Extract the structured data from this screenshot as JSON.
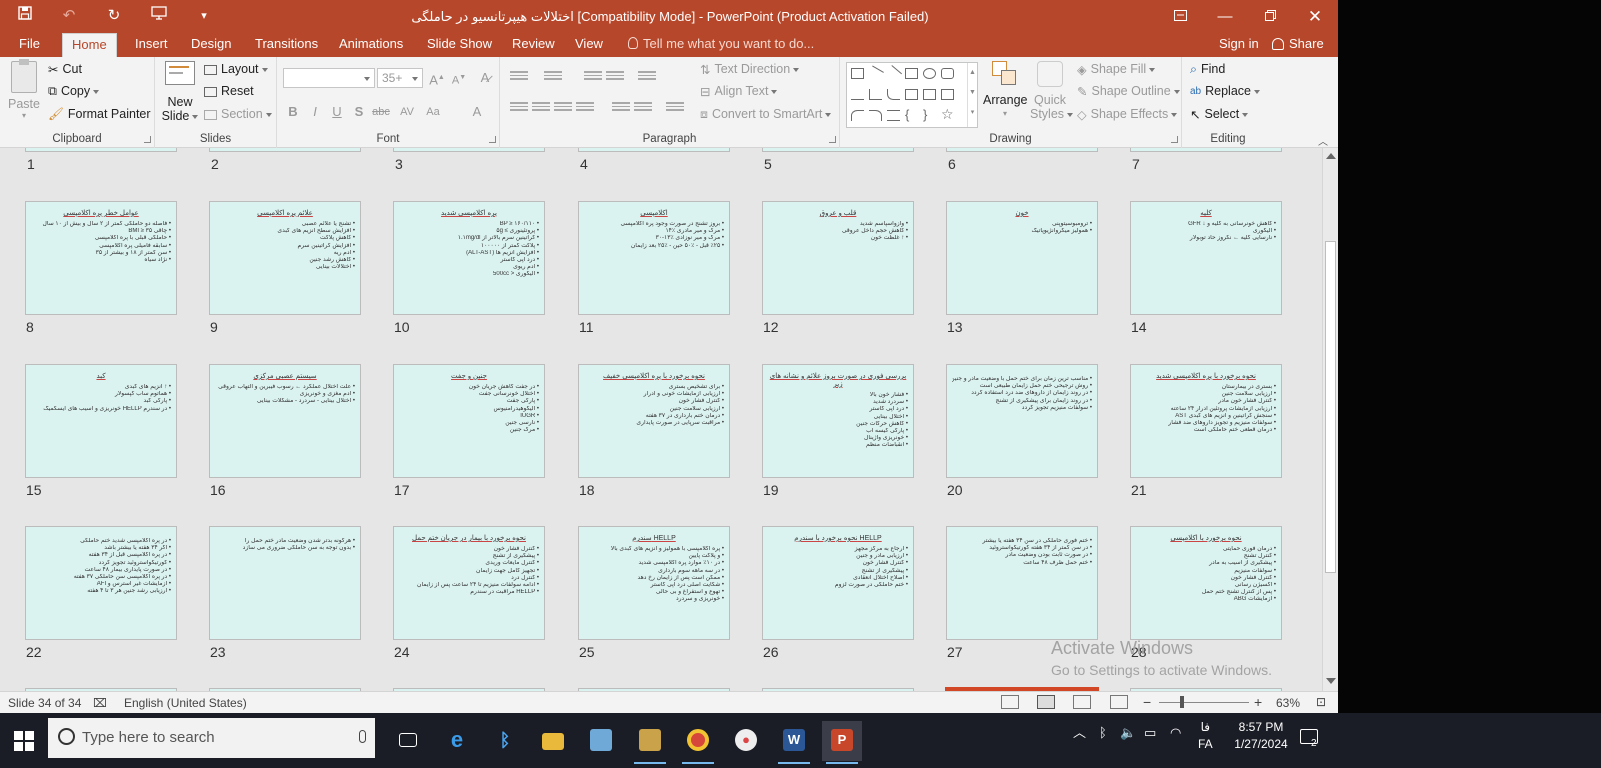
{
  "window": {
    "title": "اختلالات هیپرتانسیو در حاملگی [Compatibility Mode] - PowerPoint (Product Activation Failed)"
  },
  "tabs": [
    "File",
    "Home",
    "Insert",
    "Design",
    "Transitions",
    "Animations",
    "Slide Show",
    "Review",
    "View"
  ],
  "active_tab": "Home",
  "tell_me": "Tell me what you want to do...",
  "account": {
    "sign_in": "Sign in",
    "share": "Share"
  },
  "ribbon": {
    "clipboard": {
      "label": "Clipboard",
      "paste": "Paste",
      "cut": "Cut",
      "copy": "Copy",
      "format_painter": "Format Painter"
    },
    "slides": {
      "label": "Slides",
      "new_slide_1": "New",
      "new_slide_2": "Slide",
      "layout": "Layout",
      "reset": "Reset",
      "section": "Section"
    },
    "font": {
      "label": "Font",
      "font_name": "",
      "font_size": "35+"
    },
    "paragraph": {
      "label": "Paragraph",
      "text_direction": "Text Direction",
      "align_text": "Align Text",
      "convert_smartart": "Convert to SmartArt"
    },
    "drawing": {
      "label": "Drawing",
      "arrange": "Arrange",
      "quick_styles_1": "Quick",
      "quick_styles_2": "Styles",
      "shape_fill": "Shape Fill",
      "shape_outline": "Shape Outline",
      "shape_effects": "Shape Effects"
    },
    "editing": {
      "label": "Editing",
      "find": "Find",
      "replace": "Replace",
      "select": "Select"
    }
  },
  "slides_partial": [
    "1",
    "2",
    "3",
    "4",
    "5",
    "6",
    "7"
  ],
  "slides": [
    {
      "num": "8",
      "title": "عوامل خطر پره اکلامپسی",
      "lines": [
        "فاصله دو حاملگی کمتر از ۲ سال و بیش از ۱۰ سال",
        "چاقی BMI ≥ ۳۵",
        "حاملگی قبلی با پره اکلامپسی",
        "سابقه فامیلی پره اکلامپسی",
        "سن کمتر از ۱۸ و بیشتر از ۳۵",
        "نژاد سیاه"
      ]
    },
    {
      "num": "9",
      "title": "علائم پره اکلامپسی",
      "lines": [
        "تشنج یا علائم عصبی",
        "افزایش سطح آنزیم های کبدی",
        "کاهش پلاکت",
        "افزایش کراتینین سرم",
        "ادم ریه",
        "کاهش رشد جنین",
        "اختلالات بینایی"
      ]
    },
    {
      "num": "10",
      "title": "پره اکلامپسی شدید",
      "lines": [
        "BP ≥ ۱۶۰/۱۱۰",
        "پروتئینوری ≥ ۵g",
        "کراتینین سرم بالاتر از ۱.۱mg/dl",
        "پلاکت کمتر از ۱۰۰۰۰۰",
        "افزایش آنزیم ها (ALT-AST)",
        "درد اپی گاستر",
        "ادم ریوی",
        "الیگوری < 500cc"
      ]
    },
    {
      "num": "11",
      "title": "اکلامپسی",
      "lines": [
        "بروز تشنج در صورت وجود پره اکلامپسی",
        "مرگ و میر مادری ٪۱۴",
        "مرگ و میر نوزادی ٪۱۳-۳۰",
        "٪۲۵ قبل - ٪۵۰ حین - ٪۲۵ بعد زایمان"
      ]
    },
    {
      "num": "12",
      "title": "قلب و عروق",
      "lines": [
        "وازواسپاسم شدید",
        "کاهش حجم داخل عروقی",
        "↑ غلظت خون"
      ]
    },
    {
      "num": "13",
      "title": "خون",
      "lines": [
        "ترومبوسیتوپنی",
        "همولیز میکروآنژیوپاتیک"
      ]
    },
    {
      "num": "14",
      "title": "کلیه",
      "lines": [
        "کاهش خونرسانی به کلیه و ↓ GFR",
        "الیگوری",
        "نارسایی کلیه ← نکروز حاد توبولار"
      ]
    },
    {
      "num": "15",
      "title": "کبد",
      "lines": [
        "↑ آنزیم های کبدی",
        "هماتوم ساب کپسولار",
        "پارگی کبد",
        "در سندرم HELLP خونریزی و آسیب های ایسکمیک"
      ]
    },
    {
      "num": "16",
      "title": "سیستم عصبی مرکزی",
      "lines": [
        "علت اختلال عملکرد ← رسوب فیبرین و التهاب عروقی",
        "ادم مغزی و خونریزی",
        "اختلال بینایی - سردرد - مشکلات بینایی"
      ]
    },
    {
      "num": "17",
      "title": "جنین و جفت",
      "lines": [
        "در جفت کاهش جریان خون",
        "اختلال خونرسانی جفت",
        "پارگی جفت",
        "الیگوهیدرآمنیوس",
        "IUGR",
        "نارسی جنین",
        "مرگ جنین"
      ]
    },
    {
      "num": "18",
      "title": "نحوه برخورد با پره اکلامپسی خفیف",
      "lines": [
        "برای تشخیص بستری",
        "ارزیابی آزمایشات خونی و ادرار",
        "کنترل فشار خون",
        "ارزیابی سلامت جنین",
        "درمان ختم بارداری در ۳۷ هفته",
        "مراقبت سرپایی در صورت پایداری"
      ]
    },
    {
      "num": "19",
      "title": "بررسی فوری در صورت بروز علائم و نشانه های زیر",
      "lines": [
        "فشار خون بالا",
        "سردرد شدید",
        "درد اپی گاستر",
        "اختلال بینایی",
        "کاهش حرکات جنین",
        "پارگی کیسه آب",
        "خونریزی واژینال",
        "انقباضات منظم"
      ]
    },
    {
      "num": "20",
      "title": "",
      "lines": [
        "مناسب ترین زمان برای ختم حمل با وضعیت مادر و جنین بستگی دارد",
        "روش ترجیحی ختم حمل زایمان طبیعی است",
        "در روند زایمان از داروهای ضد درد استفاده گردد",
        "در روند زایمان برای پیشگیری از تشنج",
        "سولفات منیزیم تجویز گردد"
      ]
    },
    {
      "num": "21",
      "title": "نحوه برخورد با پره اکلامپسی شدید",
      "lines": [
        "بستری در بیمارستان",
        "ارزیابی سلامت جنین",
        "کنترل فشار خون مادر",
        "ارزیابی آزمایشات پروتئین ادرار ۲۴ ساعته",
        "سنجش کراتینین و آنزیم های کبدی AST",
        "سولفات منیزیم و تجویز داروهای ضد فشار",
        "درمان قطعی ختم حاملگی است"
      ]
    },
    {
      "num": "22",
      "title": "",
      "lines": [
        "در پره اکلامپسی شدید ختم حاملگی",
        "اگر ۳۴ هفته یا بیشتر باشد",
        "در پره اکلامپسی قبل از ۳۴ هفته",
        "کورتیکواستروئید تجویز گردد",
        "در صورت پایداری بیمار ۴۸ ساعت",
        "در پره اکلامپسی سن حاملگی ۳۷ هفته",
        "آزمایشات غیر استرس و AFI",
        "ارزیابی رشد جنین هر ۳ تا ۴ هفته"
      ]
    },
    {
      "num": "23",
      "title": "",
      "lines": [
        "هرگونه بدتر شدن وضعیت مادر ختم حمل را",
        "بدون توجه به سن حاملگی ضروری می سازد"
      ]
    },
    {
      "num": "24",
      "title": "نحوه برخورد با بیمار در جریان ختم حمل",
      "lines": [
        "کنترل فشار خون",
        "پیشگیری از تشنج",
        "کنترل مایعات وریدی",
        "تجهیز کامل جهت زایمان",
        "کنترل درد",
        "ادامه سولفات منیزیم تا ۲۴ ساعت پس از زایمان",
        "HELLP مراقبت در سندرم"
      ]
    },
    {
      "num": "25",
      "title": "سندرم HELLP",
      "lines": [
        "پره اکلامپسی با همولیز و آنزیم های کبدی بالا",
        "و پلاکت پایین",
        "در ۱۰٪ موارد پره اکلامپسی شدید",
        "در سه ماهه سوم بارداری",
        "ممکن است پس از زایمان رخ دهد",
        "شکایت اصلی درد اپی گاستر",
        "تهوع و استفراغ و بی حالی",
        "خونریزی و سردرد"
      ]
    },
    {
      "num": "26",
      "title": "نحوه برخورد با سندرم HELLP",
      "lines": [
        "ارجاع به مرکز مجهز",
        "ارزیابی مادر و جنین",
        "کنترل فشار خون",
        "پیشگیری از تشنج",
        "اصلاح اختلال انعقادی",
        "ختم حاملگی در صورت لزوم"
      ]
    },
    {
      "num": "27",
      "title": "",
      "lines": [
        "ختم فوری حاملگی در سن ۳۴ هفته یا بیشتر",
        "در سن کمتر از ۳۴ هفته کورتیکواستروئید",
        "در صورت ثابت بودن وضعیت مادر",
        "ختم حمل ظرف ۴۸ ساعت"
      ]
    },
    {
      "num": "28",
      "title": "نحوه برخورد با اکلامپسی",
      "lines": [
        "درمان فوری حمایتی",
        "کنترل تشنج",
        "پیشگیری از آسیب به مادر",
        "سولفات منیزیم",
        "کنترل فشار خون",
        "اکسیژن رسانی",
        "پس از کنترل تشنج ختم حمل",
        "آزمایشات ABG"
      ]
    }
  ],
  "activation": {
    "line1": "Activate Windows",
    "line2": "Go to Settings to activate Windows."
  },
  "statusbar": {
    "slide_info": "Slide 34 of 34",
    "language": "English (United States)",
    "zoom": "63%"
  },
  "taskbar": {
    "search_placeholder": "Type here to search",
    "apps": [
      "task-view",
      "edge",
      "bluetooth",
      "file-explorer",
      "network-share",
      "clapper",
      "chrome",
      "paint",
      "word",
      "powerpoint"
    ],
    "lang_line1": "فا",
    "lang_line2": "FA",
    "time": "8:57 PM",
    "date": "1/27/2024",
    "notifications": "2"
  },
  "colors": {
    "accent": "#b7472a",
    "slide_bg": "#dbf3f0",
    "sorter_bg": "#e6e6e6",
    "taskbar_bg": "#1b1d26"
  }
}
